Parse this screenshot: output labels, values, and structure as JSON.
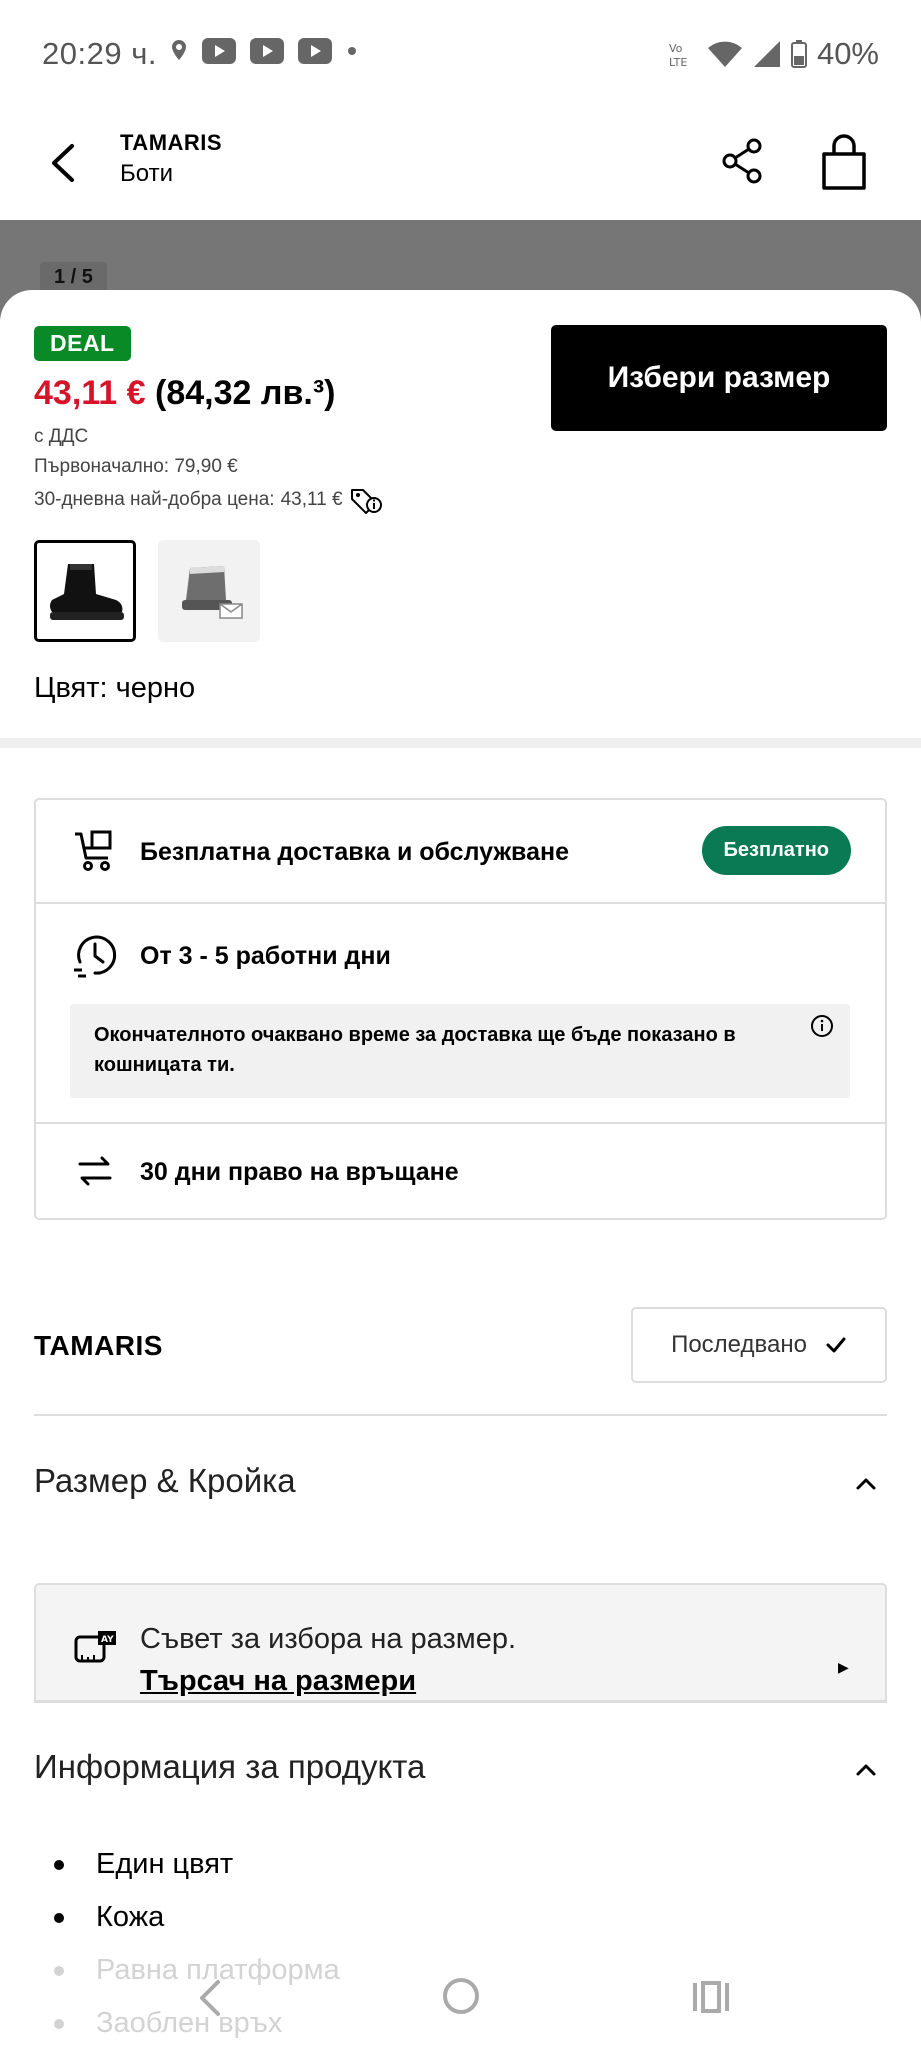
{
  "status_bar": {
    "time": "20:29 ч.",
    "battery": "40%"
  },
  "header": {
    "brand": "TAMARIS",
    "category": "Боти"
  },
  "gallery": {
    "counter": "1 / 5"
  },
  "product": {
    "badge": "DEAL",
    "price_eur": "43,11 €",
    "price_bgn": "(84,32 лв.³)",
    "vat": "с ДДС",
    "original": "Първоначално: 79,90 €",
    "best_price_label": "30-дневна най-добра цена:",
    "best_price_value": "43,11 €",
    "choose_size": "Избери размер",
    "color": "Цвят: черно"
  },
  "delivery": {
    "free_delivery": "Безплатна доставка и обслужване",
    "free_badge": "Безплатно",
    "delivery_time": "От 3 - 5 работни дни",
    "delivery_note": "Окончателното очаквано време за доставка ще бъде показано в кошницата ти.",
    "returns": "30 дни право на връщане"
  },
  "brand_section": {
    "name": "TAMARIS",
    "follow_label": "Последвано"
  },
  "size_fit": {
    "title": "Размер & Кройка",
    "advice": "Съвет за избора на размер.",
    "finder_link": "Търсач на размери"
  },
  "product_info": {
    "title": "Информация за продукта",
    "bullets": [
      "Един цвят",
      "Кожа",
      "Равна платформа",
      "Заоблен връх"
    ]
  },
  "colors": {
    "deal_green": "#0a8a26",
    "price_red": "#d7132a",
    "free_pill": "#0a7a54"
  }
}
